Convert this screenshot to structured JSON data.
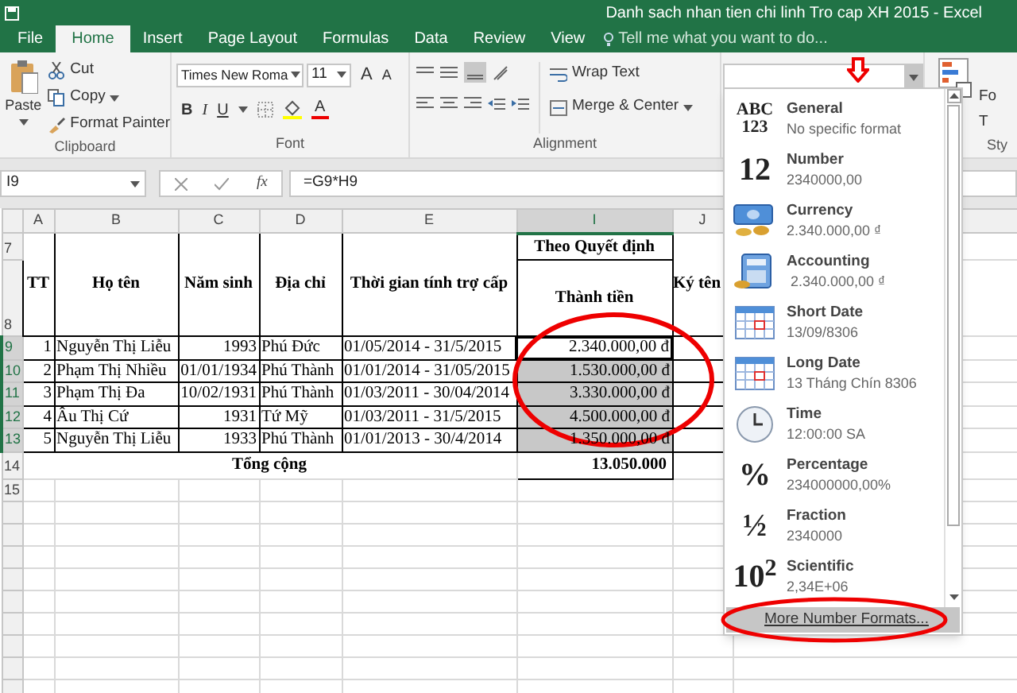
{
  "window": {
    "title": "Danh sach nhan tien chi linh Tro cap XH 2015 - Excel"
  },
  "tabs": [
    {
      "label": "File",
      "selected": false
    },
    {
      "label": "Home",
      "selected": true
    },
    {
      "label": "Insert",
      "selected": false
    },
    {
      "label": "Page Layout",
      "selected": false
    },
    {
      "label": "Formulas",
      "selected": false
    },
    {
      "label": "Data",
      "selected": false
    },
    {
      "label": "Review",
      "selected": false
    },
    {
      "label": "View",
      "selected": false
    }
  ],
  "tell_me": "Tell me what you want to do...",
  "clipboard": {
    "paste": "Paste",
    "cut": "Cut",
    "copy": "Copy",
    "format_painter": "Format Painter",
    "label": "Clipboard"
  },
  "font": {
    "name": "Times New Roma",
    "size": "11",
    "grow": "A",
    "shrink": "A",
    "bold": "B",
    "italic": "I",
    "underline": "U",
    "font_color": "A",
    "label": "Font"
  },
  "alignment": {
    "wrap_text": "Wrap Text",
    "merge": "Merge & Center",
    "label": "Alignment"
  },
  "styles": {
    "button": "Fo",
    "button_2": "T",
    "label": "Sty"
  },
  "formula_bar": {
    "name_box": "I9",
    "fx": "fx",
    "formula": "=G9*H9"
  },
  "columns": [
    {
      "label": "A",
      "selected": false
    },
    {
      "label": "B",
      "selected": false
    },
    {
      "label": "C",
      "selected": false
    },
    {
      "label": "D",
      "selected": false
    },
    {
      "label": "E",
      "selected": false
    },
    {
      "label": "I",
      "selected": true
    },
    {
      "label": "J",
      "selected": false
    }
  ],
  "header_rows": [
    "7",
    "8"
  ],
  "group_header": "Theo Quyết định",
  "headers": [
    "TT",
    "Họ tên",
    "Năm sinh",
    "Địa chỉ",
    "Thời gian tính trợ cấp",
    "Thành tiền",
    "Ký tên"
  ],
  "rows": [
    {
      "number": "9",
      "selected": true,
      "active": true,
      "cells": [
        "1",
        "Nguyễn Thị Liễu",
        "1993",
        "Phú Đức",
        "01/05/2014 - 31/5/2015",
        "2.340.000,00 đ"
      ]
    },
    {
      "number": "10",
      "selected": true,
      "active": false,
      "cells": [
        "2",
        "Phạm Thị Nhiều",
        "01/01/1934",
        "Phú Thành",
        "01/01/2014 - 31/05/2015",
        "1.530.000,00 đ"
      ]
    },
    {
      "number": "11",
      "selected": true,
      "active": false,
      "cells": [
        "3",
        "Phạm Thị Đa",
        "10/02/1931",
        "Phú Thành",
        "01/03/2011 - 30/04/2014",
        "3.330.000,00 đ"
      ]
    },
    {
      "number": "12",
      "selected": true,
      "active": false,
      "cells": [
        "4",
        "Âu Thị Cứ",
        "1931",
        "Tứ Mỹ",
        "01/03/2011 - 31/5/2015",
        "4.500.000,00 đ"
      ]
    },
    {
      "number": "13",
      "selected": true,
      "active": false,
      "cells": [
        "5",
        "Nguyễn Thị Liễu",
        "1933",
        "Phú Thành",
        "01/01/2013 - 30/4/2014",
        "1.350.000,00 đ"
      ]
    }
  ],
  "total": {
    "number": "14",
    "label": "Tổng cộng",
    "value": "13.050.000"
  },
  "empty_rows": [
    "15"
  ],
  "format_menu": {
    "items": [
      {
        "kind": "general",
        "glyph": [
          "ABC",
          "123"
        ],
        "name": "General",
        "example": "No specific format"
      },
      {
        "kind": "number",
        "glyph": [
          "12"
        ],
        "name": "Number",
        "example": "2340000,00"
      },
      {
        "kind": "currency",
        "name": "Currency",
        "example": "2.340.000,00 ₫"
      },
      {
        "kind": "accounting",
        "name": "Accounting",
        "example": " 2.340.000,00 ₫"
      },
      {
        "kind": "calendar",
        "name": "Short Date",
        "example": "13/09/8306"
      },
      {
        "kind": "calendar",
        "name": "Long Date",
        "example": "13 Tháng Chín 8306"
      },
      {
        "kind": "clock",
        "name": "Time",
        "example": "12:00:00 SA"
      },
      {
        "kind": "percent",
        "glyph": [
          "%"
        ],
        "name": "Percentage",
        "example": "234000000,00%"
      },
      {
        "kind": "fraction",
        "glyph": [
          "½"
        ],
        "name": "Fraction",
        "example": "2340000"
      },
      {
        "kind": "scientific",
        "glyph": [
          "10$^{2}$"
        ],
        "name": "Scientific",
        "example": "2,34E+06"
      }
    ],
    "more": "More Number Formats..."
  }
}
